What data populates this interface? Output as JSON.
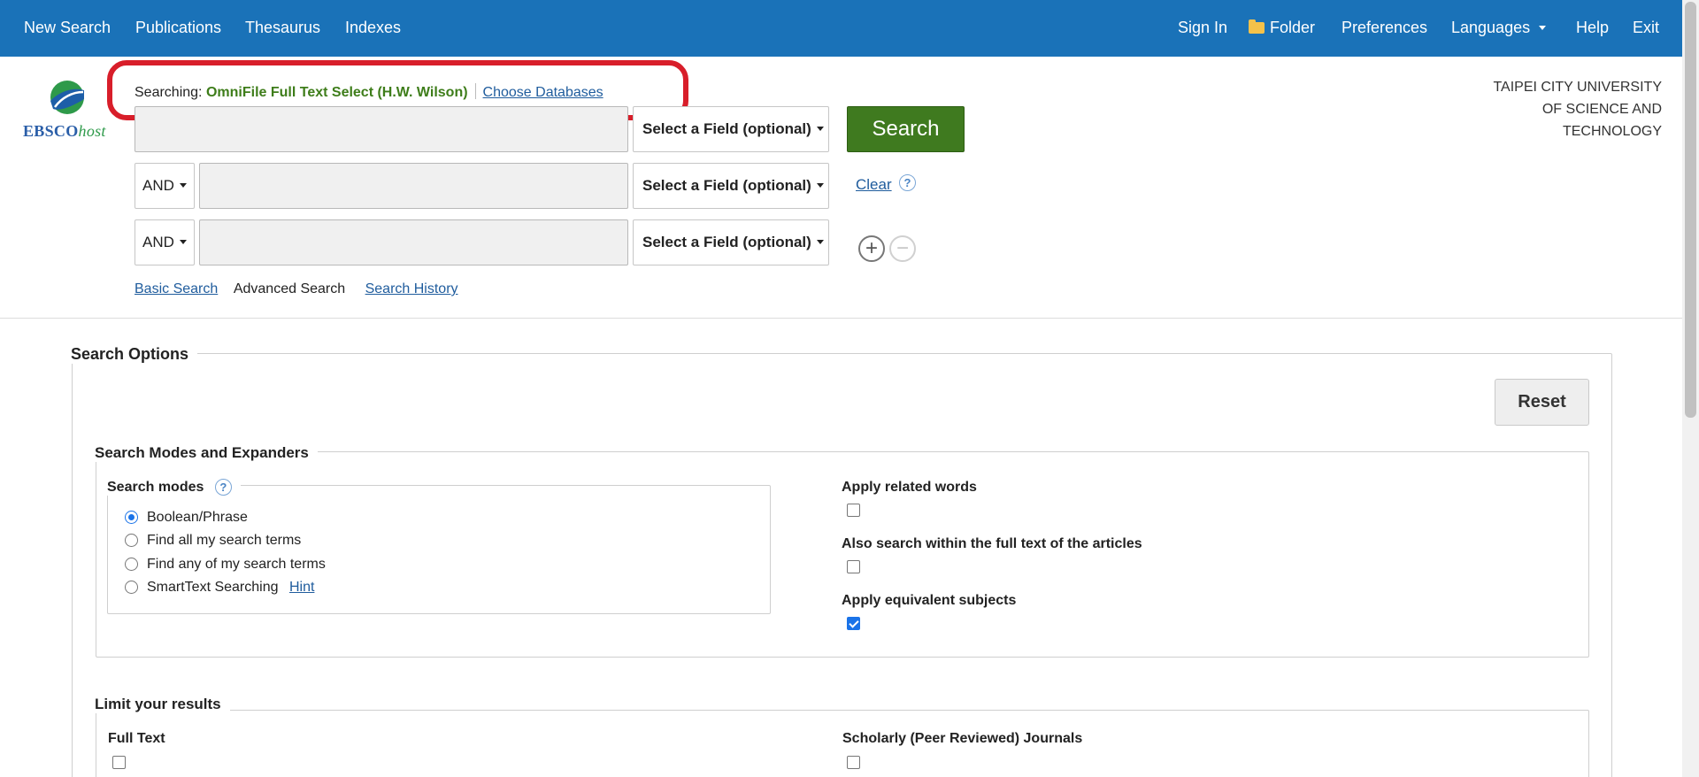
{
  "nav": {
    "left": [
      "New Search",
      "Publications",
      "Thesaurus",
      "Indexes"
    ],
    "sign_in": "Sign In",
    "folder": "Folder",
    "preferences": "Preferences",
    "languages": "Languages",
    "help": "Help",
    "exit": "Exit"
  },
  "logo": {
    "brand": "EBSCO",
    "suffix": "host"
  },
  "searching": {
    "label": "Searching:",
    "database": "OmniFile Full Text Select (H.W. Wilson)",
    "choose_link": "Choose Databases"
  },
  "institution": [
    "TAIPEI CITY UNIVERSITY",
    "OF SCIENCE AND",
    "TECHNOLOGY"
  ],
  "search_rows": [
    {
      "operator": "",
      "value": "",
      "field": "Select a Field (optional)"
    },
    {
      "operator": "AND",
      "value": "",
      "field": "Select a Field (optional)"
    },
    {
      "operator": "AND",
      "value": "",
      "field": "Select a Field (optional)"
    }
  ],
  "search_button": "Search",
  "clear_link": "Clear",
  "help_glyph": "?",
  "add_row_glyph": "+",
  "remove_row_glyph": "−",
  "view_links": {
    "basic": "Basic Search",
    "advanced": "Advanced Search",
    "history": "Search History"
  },
  "options": {
    "title": "Search Options",
    "reset": "Reset",
    "modes_section": "Search Modes and Expanders",
    "modes_title": "Search modes",
    "modes": [
      {
        "label": "Boolean/Phrase",
        "selected": true
      },
      {
        "label": "Find all my search terms",
        "selected": false
      },
      {
        "label": "Find any of my search terms",
        "selected": false
      },
      {
        "label": "SmartText Searching",
        "selected": false
      }
    ],
    "hint_link": "Hint",
    "expanders": [
      {
        "label": "Apply related words",
        "checked": false
      },
      {
        "label": "Also search within the full text of the articles",
        "checked": false
      },
      {
        "label": "Apply equivalent subjects",
        "checked": true
      }
    ],
    "limits_section": "Limit your results",
    "limits": [
      {
        "label": "Full Text",
        "checked": false
      },
      {
        "label": "Scholarly (Peer Reviewed) Journals",
        "checked": false
      }
    ]
  },
  "colors": {
    "nav_bg": "#1a72b8",
    "search_btn": "#3f7a1f",
    "db_name": "#3e7d1a",
    "highlight": "#d81e2a"
  }
}
